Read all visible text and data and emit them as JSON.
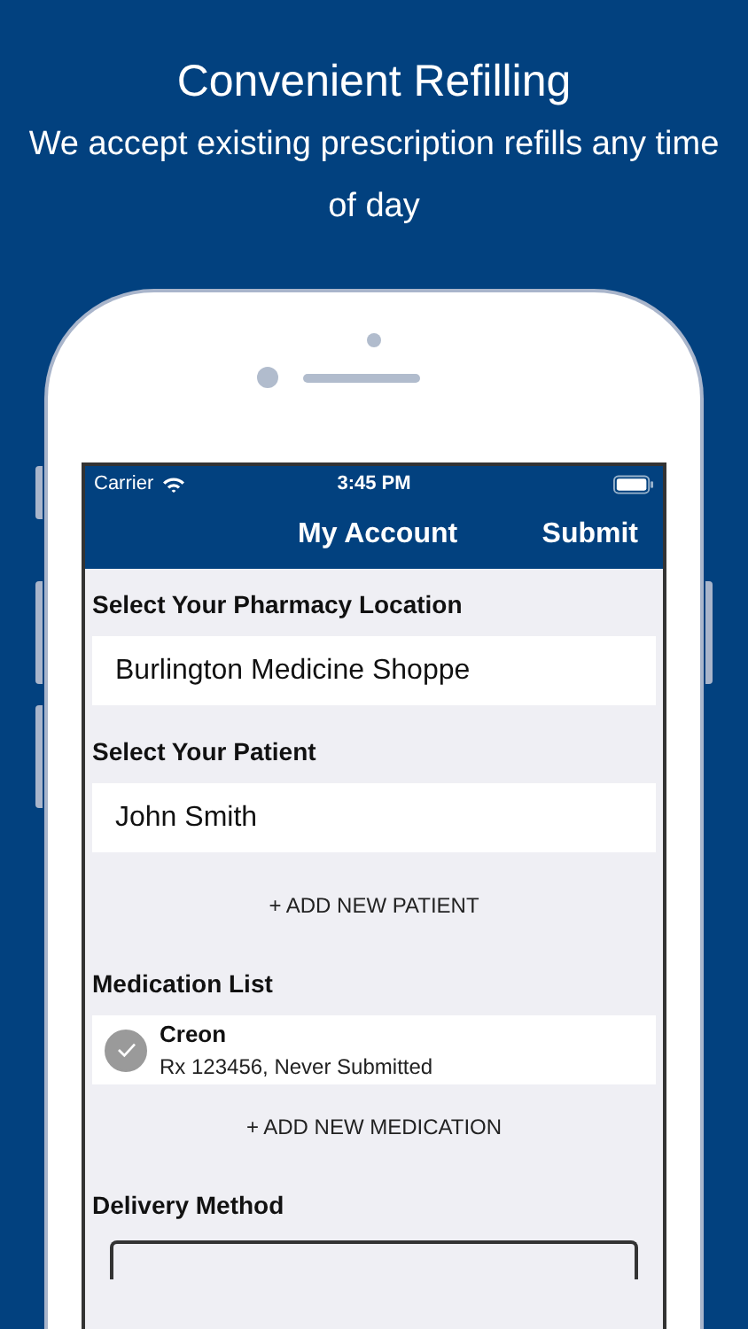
{
  "headline": "Convenient Refilling",
  "subheadline": "We accept existing prescription refills any time of day",
  "status_bar": {
    "carrier": "Carrier",
    "time": "3:45 PM"
  },
  "nav_bar": {
    "title": "My Account",
    "action": "Submit"
  },
  "sections": [
    {
      "kind": "field",
      "label": "Select Your Pharmacy Location",
      "value": "Burlington Medicine Shoppe"
    },
    {
      "kind": "field",
      "label": "Select Your Patient",
      "value": "John Smith",
      "add_button": "+ ADD NEW PATIENT"
    },
    {
      "kind": "list",
      "label": "Medication List",
      "items": [
        {
          "name": "Creon",
          "detail": "Rx 123456, Never Submitted",
          "checked": true
        }
      ],
      "add_button": "+ ADD NEW MEDICATION"
    },
    {
      "kind": "options",
      "label": "Delivery Method"
    }
  ]
}
